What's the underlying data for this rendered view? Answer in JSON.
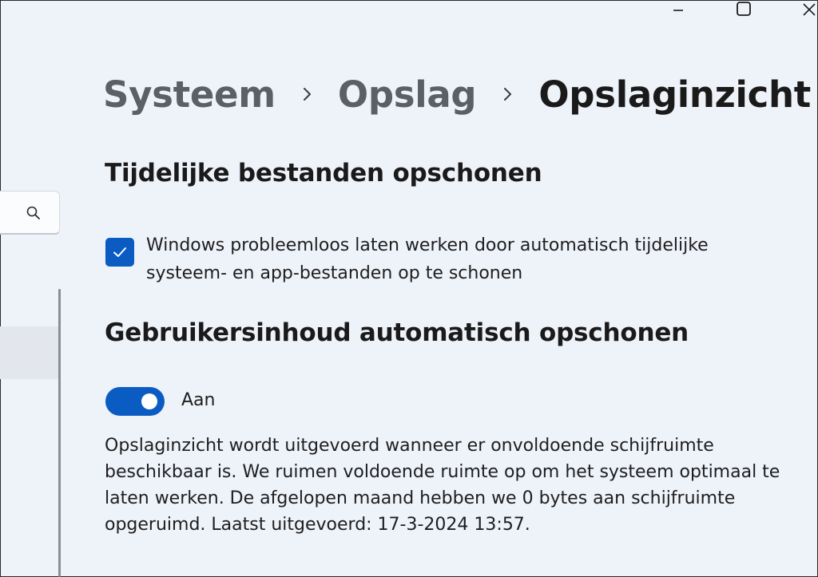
{
  "window": {
    "minimize_icon": "minimize-icon",
    "maximize_icon": "maximize-icon",
    "close_icon": "close-icon"
  },
  "sidebar": {
    "search_icon": "search-icon"
  },
  "breadcrumb": {
    "items": [
      "Systeem",
      "Opslag",
      "Opslaginzicht"
    ],
    "separator_icon": "chevron-right-icon"
  },
  "temp_files": {
    "title": "Tijdelijke bestanden opschonen",
    "checkbox_checked": true,
    "checkbox_label": "Windows probleemloos laten werken door automatisch tijdelijke systeem- en app-bestanden op te schonen"
  },
  "user_content": {
    "title": "Gebruikersinhoud automatisch opschonen",
    "toggle_on": true,
    "toggle_label": "Aan",
    "description": "Opslaginzicht wordt uitgevoerd wanneer er onvoldoende schijfruimte beschikbaar is. We ruimen voldoende ruimte op om het systeem optimaal te laten werken. De afgelopen maand hebben we 0 bytes aan schijfruimte opgeruimd. Laatst uitgevoerd: 17-3-2024 13:57."
  },
  "colors": {
    "accent": "#0b5cc2",
    "background": "#eef2f9"
  }
}
